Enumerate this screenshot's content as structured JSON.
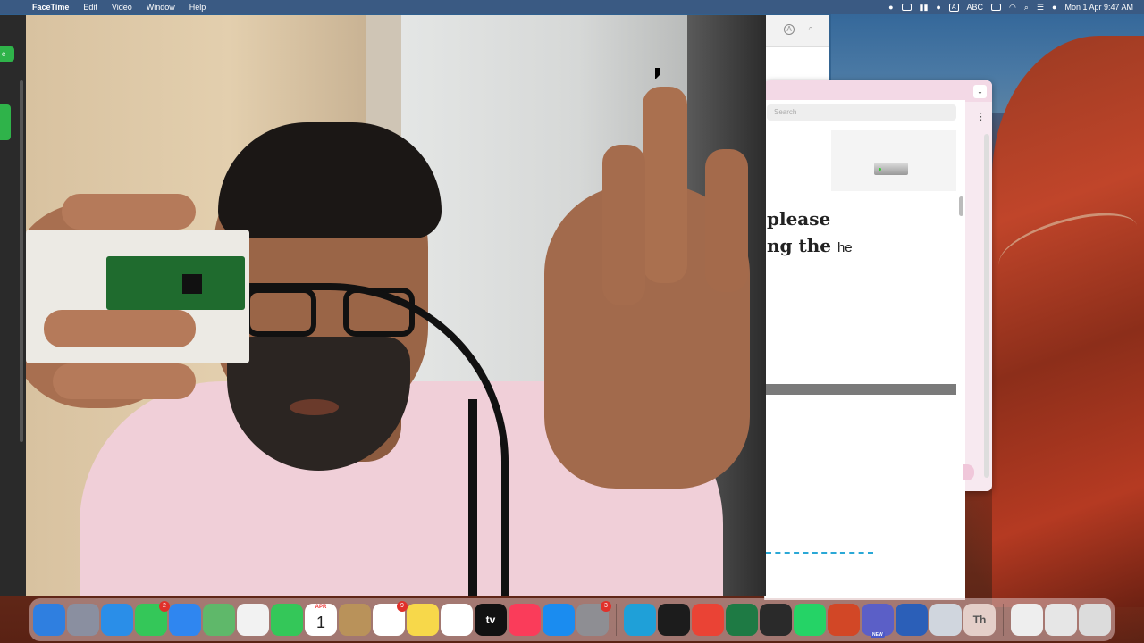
{
  "menubar": {
    "app_name": "FaceTime",
    "items": [
      "Edit",
      "Video",
      "Window",
      "Help"
    ],
    "input_label": "ABC",
    "datetime": "Mon 1 Apr  9:47 AM"
  },
  "left_window": {
    "pill_label": "e"
  },
  "browser": {
    "search_placeholder": "Search"
  },
  "document": {
    "line1": "please",
    "line2_bold": "ng the",
    "line2_small": "he"
  },
  "dock": {
    "items": [
      {
        "name": "Finder",
        "icon": "finder-icon",
        "color": "#2f7fe0"
      },
      {
        "name": "Launchpad",
        "icon": "launchpad-icon",
        "color": "#8a8fa0"
      },
      {
        "name": "Safari",
        "icon": "safari-icon",
        "color": "#2a8ee8"
      },
      {
        "name": "Messages",
        "icon": "messages-icon",
        "color": "#34c759",
        "badge": "2"
      },
      {
        "name": "Mail",
        "icon": "mail-icon",
        "color": "#2f86f0"
      },
      {
        "name": "Maps",
        "icon": "maps-icon",
        "color": "#5fb86a"
      },
      {
        "name": "Photos",
        "icon": "photos-icon",
        "color": "#f2f2f2"
      },
      {
        "name": "FaceTime",
        "icon": "facetime-icon",
        "color": "#34c759"
      },
      {
        "name": "Calendar",
        "icon": "calendar-icon",
        "color": "#ffffff",
        "month": "APR",
        "day": "1"
      },
      {
        "name": "Contacts",
        "icon": "contacts-icon",
        "color": "#b9925a"
      },
      {
        "name": "Reminders",
        "icon": "reminders-icon",
        "color": "#ffffff",
        "badge": "9"
      },
      {
        "name": "Notes",
        "icon": "notes-icon",
        "color": "#f7d84a"
      },
      {
        "name": "Freeform",
        "icon": "freeform-icon",
        "color": "#ffffff"
      },
      {
        "name": "TV",
        "icon": "tv-icon",
        "color": "#111111",
        "label": "tv"
      },
      {
        "name": "Music",
        "icon": "music-icon",
        "color": "#fa3c5a"
      },
      {
        "name": "App Store",
        "icon": "app-store-icon",
        "color": "#1a8cf0"
      },
      {
        "name": "System Settings",
        "icon": "settings-icon",
        "color": "#8e8e93",
        "badge": "3"
      },
      {
        "name": "Edge",
        "icon": "edge-icon",
        "color": "#1fa0d8"
      },
      {
        "name": "Terminal",
        "icon": "terminal-icon",
        "color": "#1c1c1c"
      },
      {
        "name": "Chrome",
        "icon": "chrome-icon",
        "color": "#ea4335"
      },
      {
        "name": "Excel",
        "icon": "excel-icon",
        "color": "#1e7a44"
      },
      {
        "name": "QuickTime",
        "icon": "quicktime-icon",
        "color": "#2a2a2a"
      },
      {
        "name": "WhatsApp",
        "icon": "whatsapp-icon",
        "color": "#25d366"
      },
      {
        "name": "PowerPoint",
        "icon": "powerpoint-icon",
        "color": "#d24726"
      },
      {
        "name": "Teams",
        "icon": "teams-icon",
        "color": "#5b5fc7",
        "new": "NEW"
      },
      {
        "name": "Word",
        "icon": "word-icon",
        "color": "#2b5fb8"
      },
      {
        "name": "Preview",
        "icon": "preview-icon",
        "color": "#d0d6de"
      },
      {
        "name": "Thonny",
        "icon": "thonny-icon",
        "color": "#e4cfc9",
        "label": "Th"
      },
      {
        "name": "Drive",
        "icon": "usb-drive-icon",
        "color": "#eeeeee"
      },
      {
        "name": "Disk",
        "icon": "disk-icon",
        "color": "#e6e6e6"
      },
      {
        "name": "Trash",
        "icon": "trash-icon",
        "color": "#dcdcdc"
      }
    ]
  }
}
